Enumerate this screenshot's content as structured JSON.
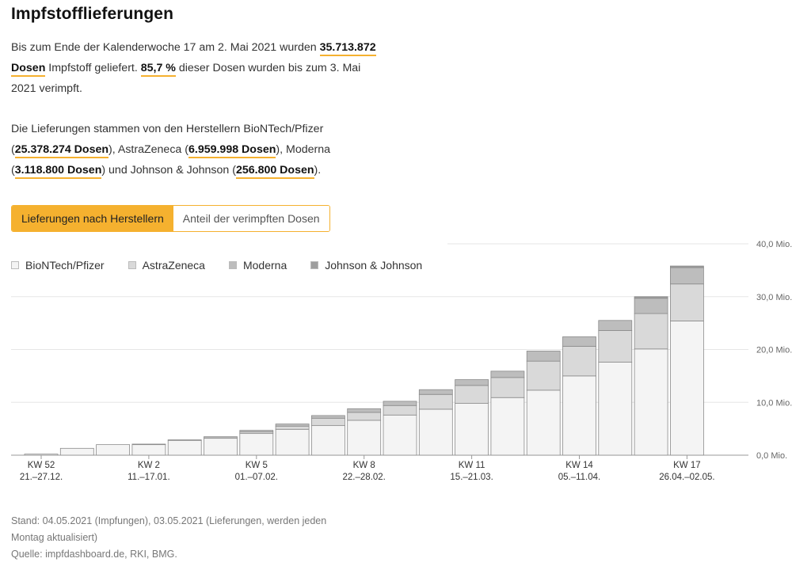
{
  "title": "Impfstofflieferungen",
  "intro": {
    "t1": "Bis zum Ende der Kalenderwoche 17 am 2. Mai 2021 wurden ",
    "total": "35.713.872 Dosen",
    "t2": " Impfstoff geliefert. ",
    "share": "85,7 %",
    "t3": " dieser Dosen wurden bis zum 3. Mai 2021 verimpft."
  },
  "makers": {
    "t1": "Die Lieferungen stammen von den Herstellern BioNTech/Pfizer (",
    "biontech": "25.378.274 Dosen",
    "t2": "), AstraZeneca (",
    "astrazeneca": "6.959.998 Dosen",
    "t3": "), Moderna (",
    "moderna": "3.118.800 Dosen",
    "t4": ") und Johnson & Johnson (",
    "jj": "256.800 Dosen",
    "t5": ")."
  },
  "tabs": [
    "Lieferungen nach Herstellern",
    "Anteil der verimpften Dosen"
  ],
  "footer": {
    "line1": "Stand: 04.05.2021 (Impfungen), 03.05.2021 (Lieferungen, werden jeden",
    "line2": "Montag aktualisiert)",
    "line3": "Quelle: impfdashboard.de, RKI, BMG."
  },
  "colors": {
    "accent": "#f5b12f",
    "biontech": "#f4f4f4",
    "astrazeneca": "#d9d9d9",
    "moderna": "#bdbdbd",
    "jj": "#9e9e9e"
  },
  "chart_data": {
    "type": "bar",
    "stacked": true,
    "legend_position": "top-left",
    "grid": true,
    "ylim": [
      0,
      40
    ],
    "yticks": [
      "0,0 Mio.",
      "10,0 Mio.",
      "20,0 Mio.",
      "30,0 Mio.",
      "40,0 Mio."
    ],
    "ytick_values": [
      0,
      10,
      20,
      30,
      40
    ],
    "categories": [
      "KW 52",
      "KW 53",
      "KW 1",
      "KW 2",
      "KW 3",
      "KW 4",
      "KW 5",
      "KW 6",
      "KW 7",
      "KW 8",
      "KW 9",
      "KW 10",
      "KW 11",
      "KW 12",
      "KW 13",
      "KW 14",
      "KW 15",
      "KW 16",
      "KW 17"
    ],
    "xtick_labels": [
      {
        "index": 0,
        "week": "KW 52",
        "dates": "21.–27.12."
      },
      {
        "index": 3,
        "week": "KW 2",
        "dates": "11.–17.01."
      },
      {
        "index": 6,
        "week": "KW 5",
        "dates": "01.–07.02."
      },
      {
        "index": 9,
        "week": "KW 8",
        "dates": "22.–28.02."
      },
      {
        "index": 12,
        "week": "KW 11",
        "dates": "15.–21.03."
      },
      {
        "index": 15,
        "week": "KW 14",
        "dates": "05.–11.04."
      },
      {
        "index": 18,
        "week": "KW 17",
        "dates": "26.04.–02.05."
      }
    ],
    "series": [
      {
        "name": "BioNTech/Pfizer",
        "values": [
          0.2,
          1.3,
          2.0,
          2.0,
          2.8,
          3.2,
          4.1,
          4.9,
          5.6,
          6.6,
          7.6,
          8.7,
          9.8,
          10.9,
          12.3,
          15.0,
          17.6,
          20.1,
          25.4
        ]
      },
      {
        "name": "AstraZeneca",
        "values": [
          0,
          0,
          0,
          0,
          0,
          0,
          0.3,
          0.6,
          1.4,
          1.5,
          1.8,
          2.8,
          3.4,
          3.8,
          5.5,
          5.6,
          6.0,
          6.7,
          7.0
        ]
      },
      {
        "name": "Moderna",
        "values": [
          0,
          0,
          0,
          0.1,
          0.1,
          0.3,
          0.3,
          0.4,
          0.5,
          0.7,
          0.8,
          0.9,
          1.1,
          1.2,
          1.9,
          1.8,
          1.9,
          2.9,
          3.1
        ]
      },
      {
        "name": "Johnson & Johnson",
        "values": [
          0,
          0,
          0,
          0,
          0,
          0,
          0,
          0,
          0,
          0,
          0,
          0,
          0,
          0,
          0,
          0,
          0,
          0.3,
          0.3
        ]
      }
    ]
  }
}
